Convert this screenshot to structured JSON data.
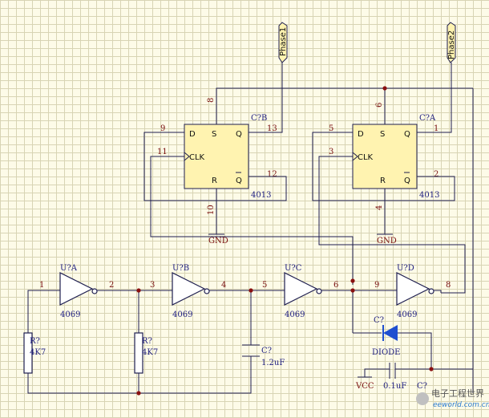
{
  "ports": {
    "phase1": "Phase1",
    "phase2": "Phase2"
  },
  "ffB": {
    "ref": "C?B",
    "part": "4013",
    "pin_d": "D",
    "pin_s": "S",
    "pin_q": "Q",
    "pin_clk": "CLK",
    "pin_r": "R",
    "pin_qbar": "Q",
    "n_s": "8",
    "n_d": "9",
    "n_q": "13",
    "n_clk": "11",
    "n_qbar": "12",
    "n_r": "10"
  },
  "ffA": {
    "ref": "C?A",
    "part": "4013",
    "pin_d": "D",
    "pin_s": "S",
    "pin_q": "Q",
    "pin_clk": "CLK",
    "pin_r": "R",
    "pin_qbar": "Q",
    "n_s": "6",
    "n_d": "5",
    "n_q": "1",
    "n_clk": "3",
    "n_qbar": "2",
    "n_r": "4"
  },
  "gnd_b": "GND",
  "gnd_a": "GND",
  "inverters": [
    {
      "ref": "U?A",
      "part": "4069",
      "in": "1",
      "out": "2"
    },
    {
      "ref": "U?B",
      "part": "4069",
      "in": "3",
      "out": "4"
    },
    {
      "ref": "U?C",
      "part": "4069",
      "in": "5",
      "out": "6"
    },
    {
      "ref": "U?D",
      "part": "4069",
      "in": "9",
      "out": "8"
    }
  ],
  "r1": {
    "ref": "R?",
    "value": "4K7"
  },
  "r2": {
    "ref": "R?",
    "value": "4K7"
  },
  "c1": {
    "ref": "C?",
    "value": "1.2uF"
  },
  "diode": {
    "ref": "C?",
    "value": "DIODE"
  },
  "c2": {
    "ref": "C?",
    "value": "0.1uF"
  },
  "vcc": "VCC",
  "watermark": {
    "cn": "电子工程世界",
    "url": "eeworld.com.cn"
  },
  "colors": {
    "wire": "#1e1e50",
    "junction": "#8a1010",
    "part_fill": "#fff3b0",
    "diode": "#1f4fd0"
  }
}
